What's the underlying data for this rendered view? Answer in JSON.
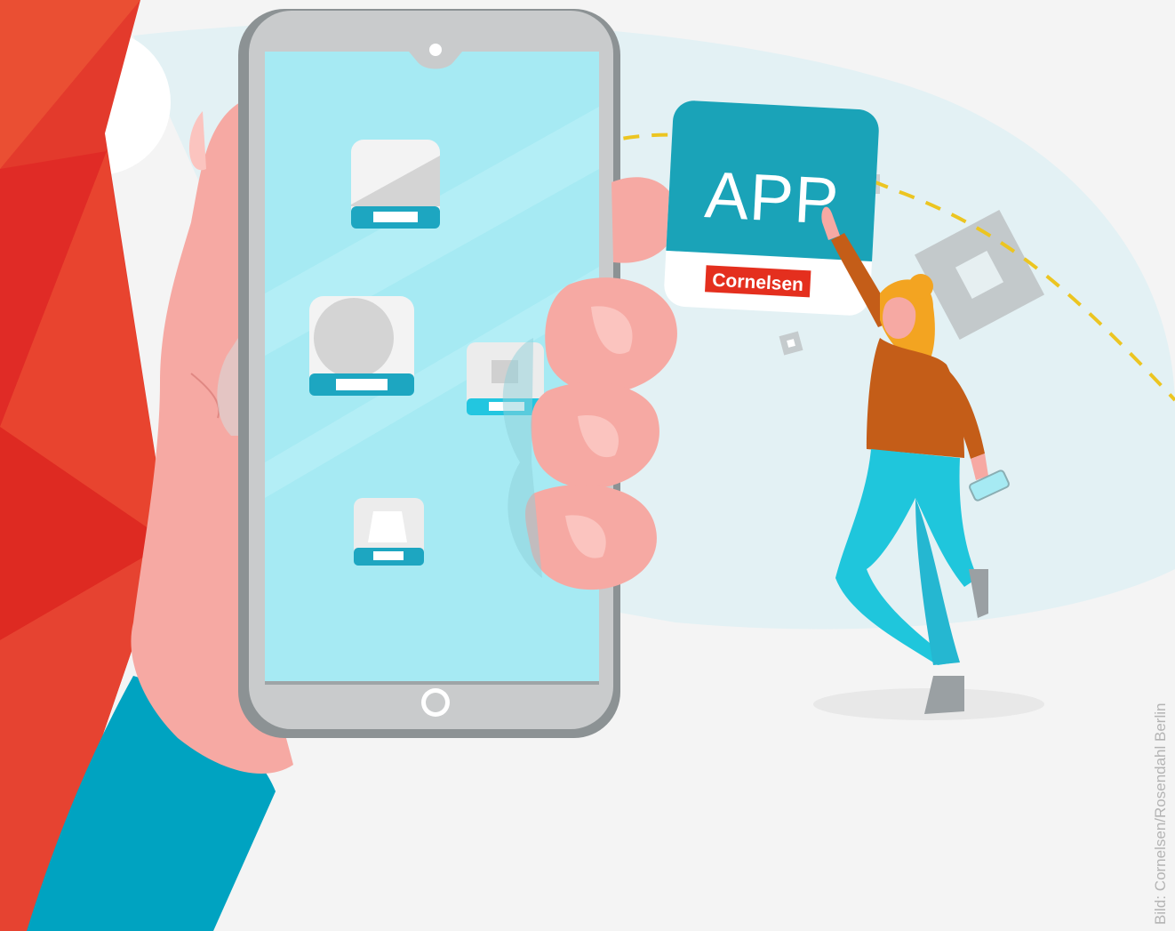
{
  "illustration": {
    "app_card_title": "APP",
    "app_card_brand": "Cornelsen",
    "credit": "Bild: Cornelsen/Rosendahl Berlin"
  },
  "colors": {
    "background": "#f4f4f4",
    "red_accent": "#e33a2c",
    "teal_sleeve": "#00a3c1",
    "screen": "#a6eaf3",
    "card": "#1aa3b8",
    "brand_label": "#e42f1e",
    "skin": "#f6a9a3",
    "shirt": "#c45d18",
    "trousers": "#1fc6dc",
    "dashed_path": "#ecc521"
  },
  "icons": [
    "hand-icon",
    "smartphone-icon",
    "app-tile-icon",
    "person-icon",
    "photo-placeholder-icon"
  ]
}
